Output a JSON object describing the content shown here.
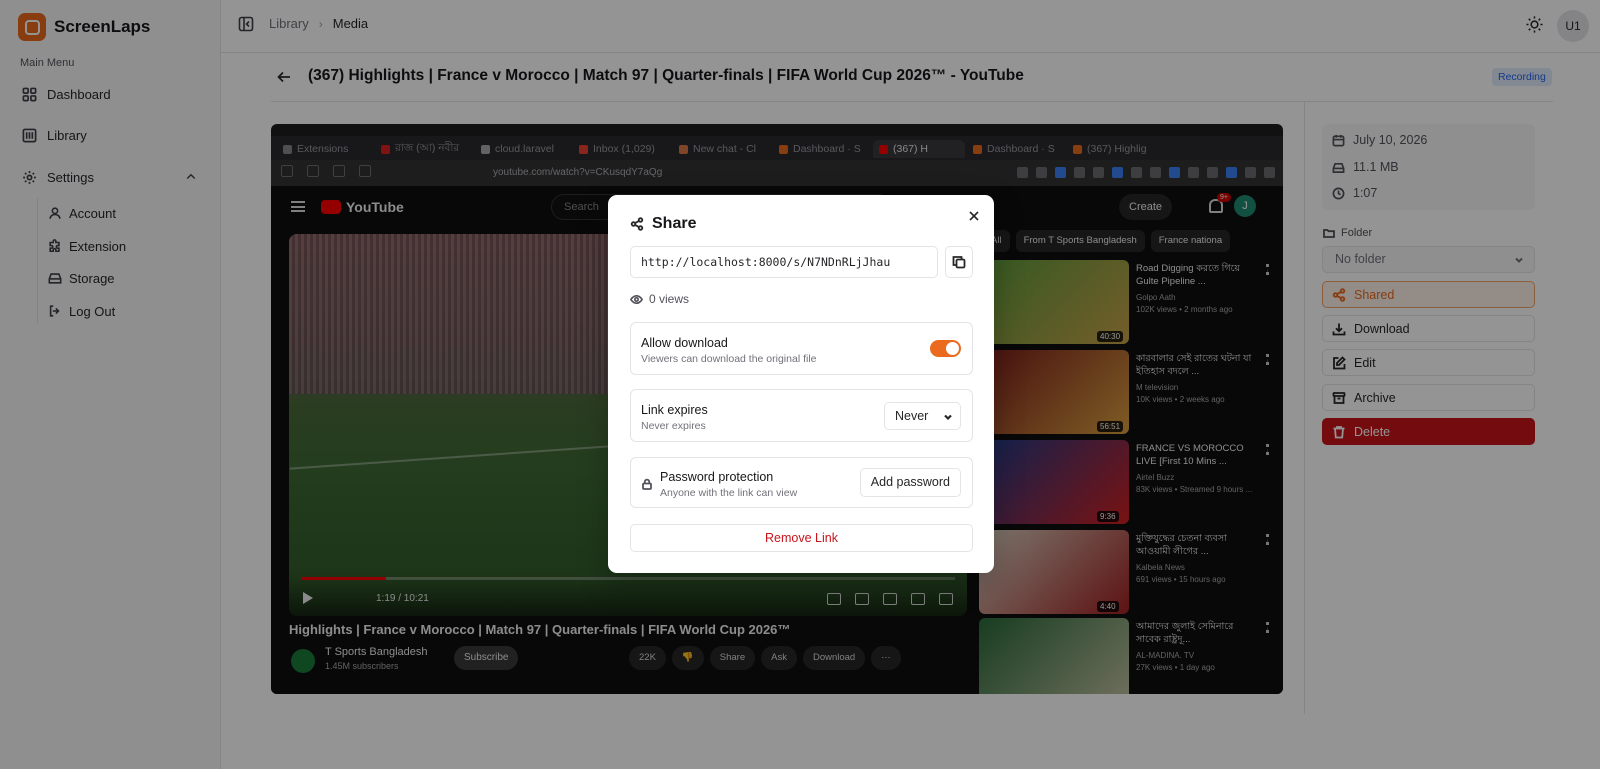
{
  "brand": {
    "name": "ScreenLaps",
    "accent": "#ea6a1e"
  },
  "sidebar": {
    "menu_label": "Main Menu",
    "items": [
      {
        "label": "Dashboard",
        "icon": "grid-icon"
      },
      {
        "label": "Library",
        "icon": "library-icon"
      },
      {
        "label": "Settings",
        "icon": "gear-icon"
      }
    ],
    "settings_sub": [
      {
        "label": "Account",
        "icon": "user-icon"
      },
      {
        "label": "Extension",
        "icon": "puzzle-icon"
      },
      {
        "label": "Storage",
        "icon": "storage-icon"
      },
      {
        "label": "Log Out",
        "icon": "logout-icon"
      }
    ]
  },
  "header": {
    "breadcrumb": [
      "Library",
      "Media"
    ],
    "avatar": "U1"
  },
  "media": {
    "title": "(367) Highlights | France v Morocco | Match 97 | Quarter-finals | FIFA World Cup 2026™ - YouTube",
    "badge": "Recording",
    "date": "July 10, 2026",
    "size": "11.1 MB",
    "duration": "1:07"
  },
  "panel": {
    "folder_label": "Folder",
    "folder_value": "No folder",
    "shared": "Shared",
    "download": "Download",
    "edit": "Edit",
    "archive": "Archive",
    "delete": "Delete",
    "delete_color": "#c8141a"
  },
  "recording": {
    "tabs": [
      "Extensions",
      "রাজ (আ) নবীর",
      "cloud.laravel",
      "Inbox (1,029)",
      "New chat - Cl",
      "Dashboard · S",
      "(367) H",
      "Dashboard · S",
      "(367) Highlig"
    ],
    "address": "youtube.com/watch?v=CKusqdY7aQg",
    "yt_logo": "YouTube",
    "yt_search": "Search",
    "yt_create": "Create",
    "yt_notif": "9+",
    "yt_avatar": "J",
    "player_time": "1:19 / 10:21",
    "player_progress": 0.13,
    "video_title": "Highlights | France v Morocco | Match 97 | Quarter-finals | FIFA World Cup 2026™",
    "channel": "T Sports Bangladesh",
    "subscribers": "1.45M subscribers",
    "subscribe": "Subscribe",
    "actions": [
      "22K",
      "",
      "Share",
      "Ask",
      "Download",
      "···"
    ],
    "chips": [
      "All",
      "From T Sports Bangladesh",
      "France nationa"
    ],
    "recs": [
      {
        "title": "Road Digging করতে গিয়ে Gulte Pipeline ...",
        "channel": "Golpo Aath",
        "meta": "102K views • 2 months ago",
        "duration": "40:30"
      },
      {
        "title": "কারবালার সেই রাতের ঘটনা যা ইতিহাস বদলে ...",
        "channel": "M television",
        "meta": "10K views • 2 weeks ago",
        "duration": "56:51"
      },
      {
        "title": "FRANCE VS MOROCCO LIVE [First 10 Mins ...",
        "channel": "Airtel Buzz",
        "meta": "83K views • Streamed 9 hours ...",
        "duration": "9:36"
      },
      {
        "title": "মুক্তিযুদ্ধের চেতনা ব্যবসা আওয়ামী লীগের ...",
        "channel": "Kalbela News",
        "meta": "691 views • 15 hours ago",
        "duration": "4:40"
      },
      {
        "title": "আমাদের জুলাই সেমিনারে সাবেক রাষ্ট্রদূ...",
        "channel": "AL-MADINA. TV",
        "meta": "27K views • 1 day ago",
        "duration": ""
      }
    ]
  },
  "share": {
    "title": "Share",
    "url": "http://localhost:8000/s/N7NDnRLjJhau",
    "views": "0 views",
    "allow_download_title": "Allow download",
    "allow_download_sub": "Viewers can download the original file",
    "allow_download_on": true,
    "expires_title": "Link expires",
    "expires_sub": "Never expires",
    "expires_value": "Never",
    "password_title": "Password protection",
    "password_sub": "Anyone with the link can view",
    "add_password": "Add password",
    "remove_link": "Remove Link"
  }
}
